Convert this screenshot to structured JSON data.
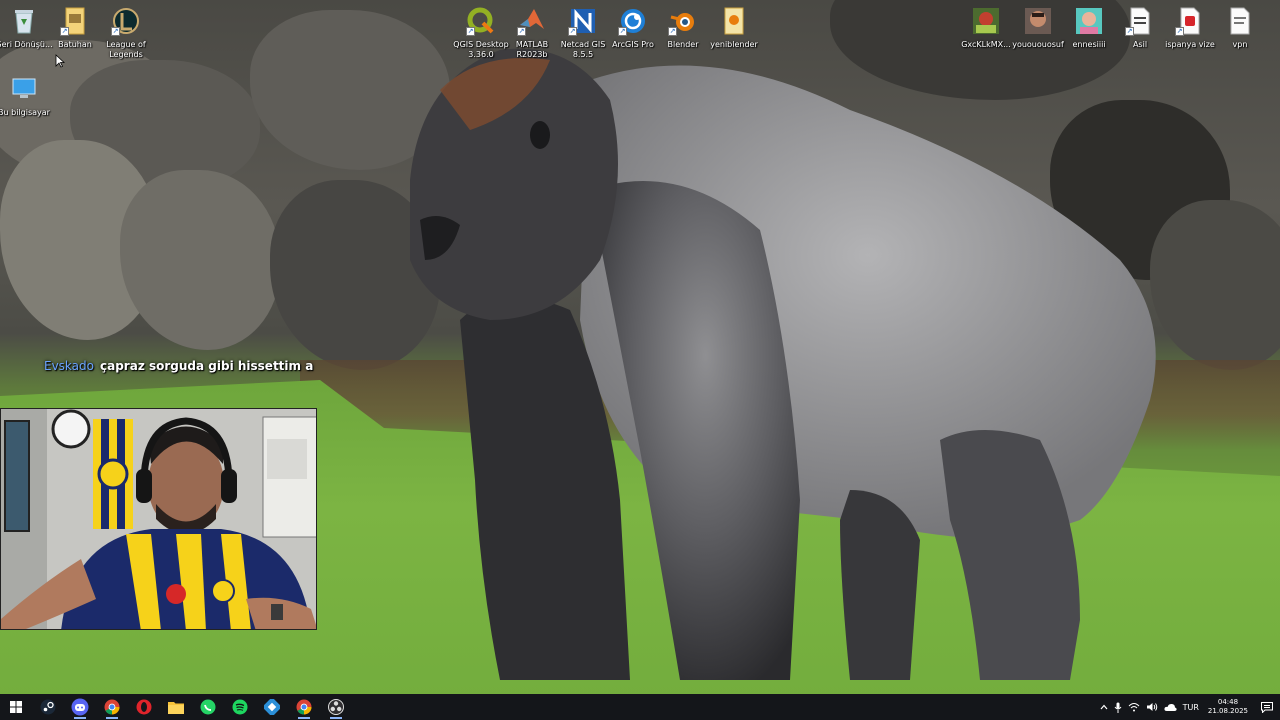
{
  "desktop": {
    "icons_left": [
      {
        "label": "Geri Dönüşü...",
        "icon": "recycle-bin-icon"
      },
      {
        "label": "Batuhan",
        "icon": "folder-icon"
      },
      {
        "label": "League of Legends",
        "icon": "league-of-legends-icon"
      },
      {
        "label": "Bu bilgisayar",
        "icon": "this-pc-icon"
      }
    ],
    "icons_center": [
      {
        "label": "QGIS Desktop 3.36.0",
        "icon": "qgis-icon"
      },
      {
        "label": "MATLAB R2023b",
        "icon": "matlab-icon"
      },
      {
        "label": "Netcad GIS 8.5.5",
        "icon": "netcad-icon"
      },
      {
        "label": "ArcGIS Pro",
        "icon": "arcgis-icon"
      },
      {
        "label": "Blender",
        "icon": "blender-icon"
      },
      {
        "label": "yeniblender",
        "icon": "folder-icon"
      }
    ],
    "icons_right": [
      {
        "label": "GxcKLkMX...",
        "icon": "image-file-icon"
      },
      {
        "label": "youououosuf",
        "icon": "image-file-icon"
      },
      {
        "label": "ennesiiii",
        "icon": "image-file-icon"
      },
      {
        "label": "Asil",
        "icon": "document-icon"
      },
      {
        "label": "ispanya vize",
        "icon": "pdf-file-icon"
      },
      {
        "label": "vpn",
        "icon": "document-icon"
      }
    ]
  },
  "chat": {
    "username": "Evskado",
    "message": "çapraz sorguda gibi hissettim a",
    "username_color": "#6aa3ff"
  },
  "taskbar": {
    "apps": [
      {
        "name": "start-button",
        "icon": "windows-icon"
      },
      {
        "name": "steam-app",
        "icon": "steam-icon"
      },
      {
        "name": "discord-app",
        "icon": "discord-icon"
      },
      {
        "name": "chrome-app",
        "icon": "chrome-icon"
      },
      {
        "name": "opera-app",
        "icon": "opera-icon"
      },
      {
        "name": "file-explorer-app",
        "icon": "folder-icon"
      },
      {
        "name": "whatsapp-app",
        "icon": "whatsapp-icon"
      },
      {
        "name": "spotify-app",
        "icon": "spotify-icon"
      },
      {
        "name": "vpn-app",
        "icon": "vpn-icon"
      },
      {
        "name": "chrome-profile-app",
        "icon": "chrome-icon"
      },
      {
        "name": "obs-app",
        "icon": "obs-icon"
      }
    ],
    "tray": {
      "language": "TUR",
      "time": "04:48",
      "date": "21.08.2025"
    }
  },
  "colors": {
    "taskbar_bg": "#14161a",
    "accent": "#8ab4f8"
  }
}
